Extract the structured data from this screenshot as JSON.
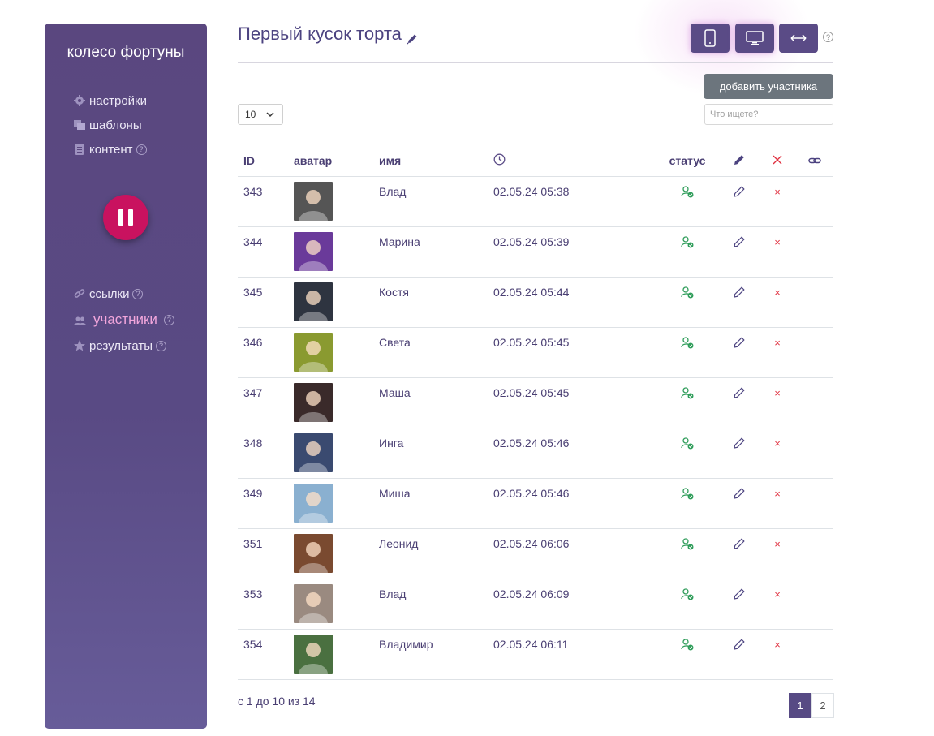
{
  "sidebar": {
    "app_title": "колесо фортуны",
    "top_items": [
      {
        "label": "настройки",
        "icon": "gear-icon"
      },
      {
        "label": "шаблоны",
        "icon": "copy-icon"
      },
      {
        "label": "контент",
        "icon": "document-icon",
        "help": "?"
      }
    ],
    "bottom_items": [
      {
        "label": "ссылки",
        "icon": "link-icon",
        "help": "?"
      },
      {
        "label": "участники",
        "icon": "users-icon",
        "help": "?",
        "active": true
      },
      {
        "label": "результаты",
        "icon": "star-icon",
        "help": "?"
      }
    ],
    "pause_icon": "pause-icon"
  },
  "header": {
    "title": "Первый кусок торта",
    "help": "?"
  },
  "toolbar": {
    "add_label": "добавить участника",
    "page_length": "10",
    "search_placeholder": "Что ищете?"
  },
  "table": {
    "headers": {
      "id": "ID",
      "avatar": "аватар",
      "name": "имя",
      "status": "статус"
    },
    "rows": [
      {
        "id": "343",
        "name": "Влад",
        "time": "02.05.24 05:38",
        "avatar_color": "#555555"
      },
      {
        "id": "344",
        "name": "Марина",
        "time": "02.05.24 05:39",
        "avatar_color": "#6a3a9a"
      },
      {
        "id": "345",
        "name": "Костя",
        "time": "02.05.24 05:44",
        "avatar_color": "#2e3440"
      },
      {
        "id": "346",
        "name": "Света",
        "time": "02.05.24 05:45",
        "avatar_color": "#8a9a30"
      },
      {
        "id": "347",
        "name": "Маша",
        "time": "02.05.24 05:45",
        "avatar_color": "#3a2a2a"
      },
      {
        "id": "348",
        "name": "Инга",
        "time": "02.05.24 05:46",
        "avatar_color": "#3a4a70"
      },
      {
        "id": "349",
        "name": "Миша",
        "time": "02.05.24 05:46",
        "avatar_color": "#8ab0d0"
      },
      {
        "id": "351",
        "name": "Леонид",
        "time": "02.05.24 06:06",
        "avatar_color": "#7a4a30"
      },
      {
        "id": "353",
        "name": "Влад",
        "time": "02.05.24 06:09",
        "avatar_color": "#9a8a80"
      },
      {
        "id": "354",
        "name": "Владимир",
        "time": "02.05.24 06:11",
        "avatar_color": "#4a7040"
      }
    ]
  },
  "footer": {
    "info": "с 1 до 10 из 14",
    "pages": [
      "1",
      "2"
    ],
    "current_page": "1"
  },
  "colors": {
    "accent": "#5a4b86",
    "status_green": "#2f9d5a",
    "delete_red": "#e0303f",
    "pause_magenta": "#c9125f"
  }
}
